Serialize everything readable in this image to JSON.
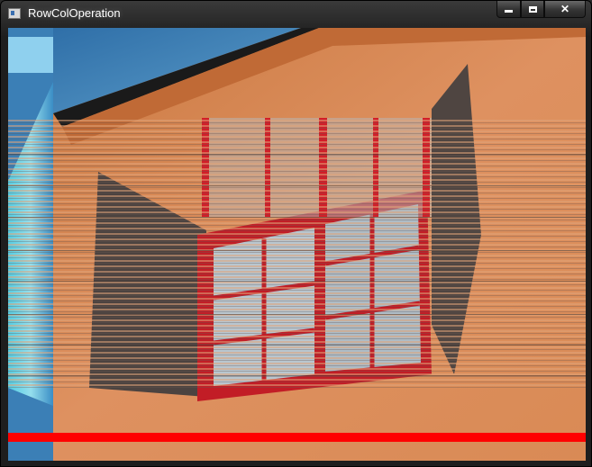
{
  "window": {
    "title": "RowColOperation",
    "icon": "app-window-icon",
    "controls": {
      "minimize": "minimize-icon",
      "maximize": "maximize-icon",
      "close": "✕"
    }
  },
  "image": {
    "description_colors": {
      "wall": "#d98a55",
      "sky": "#3e7fb5",
      "window_frame": "#d0202a",
      "glass": "#b9c6cf",
      "shutter": "#5a4d48",
      "red_stripe": "#ff0000"
    }
  }
}
